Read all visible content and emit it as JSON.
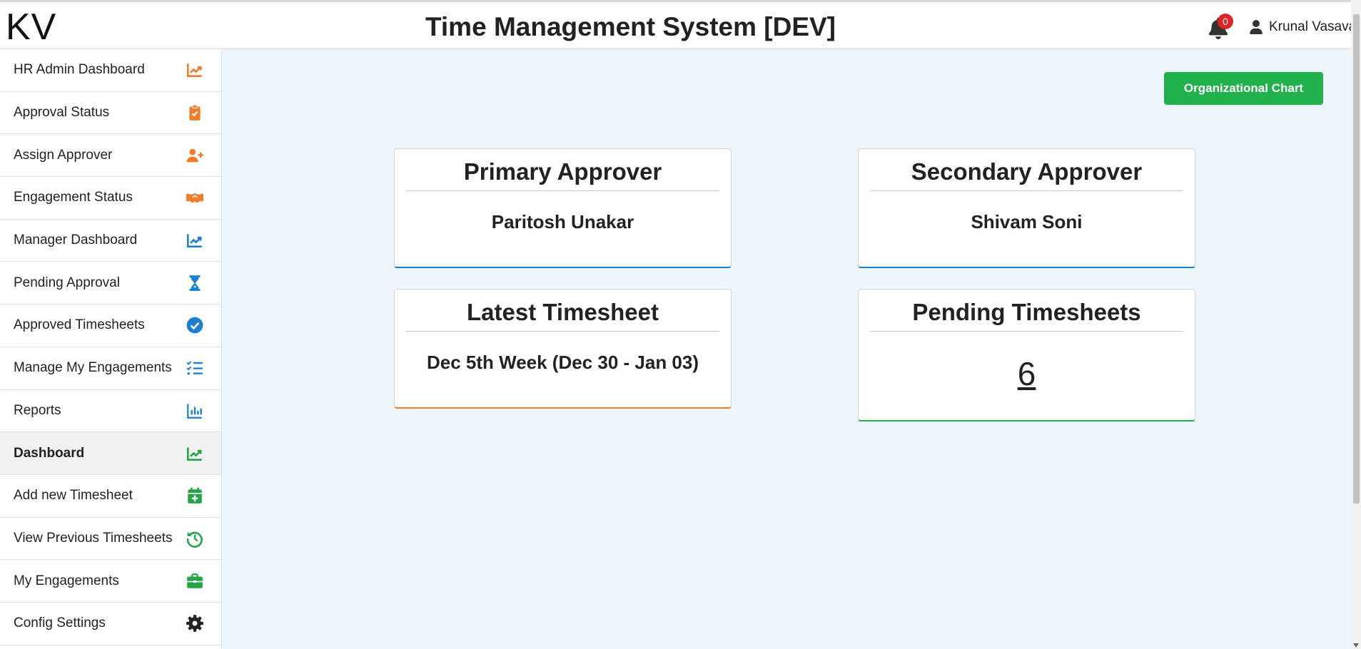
{
  "header": {
    "logo": "KV",
    "title": "Time Management System [DEV]",
    "notification_count": "0",
    "user_name": "Krunal Vasava"
  },
  "sidebar": {
    "items": [
      {
        "label": "HR Admin Dashboard",
        "icon": "chart-line-icon",
        "color": "#f07c2a"
      },
      {
        "label": "Approval Status",
        "icon": "clipboard-check-icon",
        "color": "#f07c2a"
      },
      {
        "label": "Assign Approver",
        "icon": "user-plus-icon",
        "color": "#f07c2a"
      },
      {
        "label": "Engagement Status",
        "icon": "handshake-icon",
        "color": "#f07c2a"
      },
      {
        "label": "Manager Dashboard",
        "icon": "chart-line-icon",
        "color": "#1e7fd1"
      },
      {
        "label": "Pending Approval",
        "icon": "hourglass-icon",
        "color": "#1e7fd1"
      },
      {
        "label": "Approved Timesheets",
        "icon": "check-circle-icon",
        "color": "#1e7fd1"
      },
      {
        "label": "Manage My Engagements",
        "icon": "list-check-icon",
        "color": "#1e7fd1"
      },
      {
        "label": "Reports",
        "icon": "bar-chart-icon",
        "color": "#1e7fd1"
      },
      {
        "label": "Dashboard",
        "icon": "chart-line-icon",
        "color": "#22a447",
        "active": true
      },
      {
        "label": "Add new Timesheet",
        "icon": "calendar-plus-icon",
        "color": "#22a447"
      },
      {
        "label": "View Previous Timesheets",
        "icon": "history-icon",
        "color": "#22a447"
      },
      {
        "label": "My Engagements",
        "icon": "briefcase-icon",
        "color": "#22a447"
      },
      {
        "label": "Config Settings",
        "icon": "gear-icon",
        "color": "#222222"
      }
    ]
  },
  "actions": {
    "org_chart_label": "Organizational Chart"
  },
  "cards": {
    "primary_approver": {
      "title": "Primary Approver",
      "value": "Paritosh Unakar",
      "accent": "#1e7fd1"
    },
    "secondary_approver": {
      "title": "Secondary Approver",
      "value": "Shivam Soni",
      "accent": "#1e7fd1"
    },
    "latest_timesheet": {
      "title": "Latest Timesheet",
      "value": "Dec 5th Week (Dec 30 - Jan 03)",
      "accent": "#f07c2a"
    },
    "pending_timesheets": {
      "title": "Pending Timesheets",
      "value": "6",
      "accent": "#22b24c"
    }
  }
}
